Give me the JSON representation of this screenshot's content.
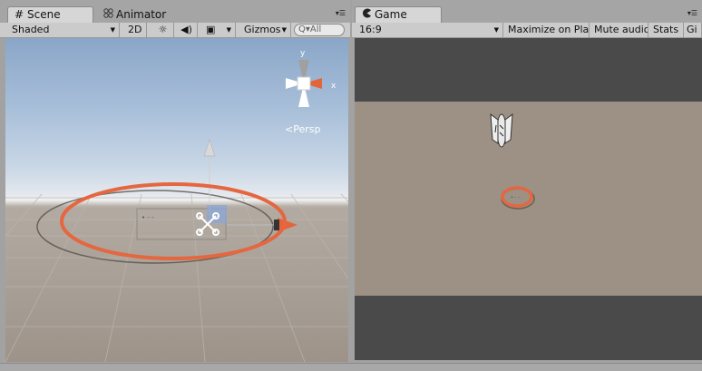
{
  "scene_panel": {
    "tabs": [
      {
        "label": "Scene",
        "icon": "hash-icon",
        "active": true
      },
      {
        "label": "Animator",
        "icon": "animator-icon",
        "active": false
      }
    ],
    "toolbar": {
      "shading_mode": "Shaded",
      "mode_2d": "2D",
      "gizmos_label": "Gizmos",
      "search_placeholder": "All",
      "search_prefix": "Q▾"
    },
    "projection_label": "Persp",
    "gizmo_axes": {
      "y": "y",
      "x": "x"
    }
  },
  "game_panel": {
    "tabs": [
      {
        "label": "Game",
        "icon": "pacman-icon",
        "active": true
      }
    ],
    "toolbar": {
      "aspect_ratio": "16:9",
      "maximize_on_play": "Maximize on Play",
      "mute_audio": "Mute audio",
      "stats": "Stats",
      "gizmos_truncated": "Gi"
    }
  },
  "colors": {
    "highlight_ellipse": "#e4673f",
    "game_background": "#9c9184",
    "letterbox": "#4a4a4a"
  }
}
